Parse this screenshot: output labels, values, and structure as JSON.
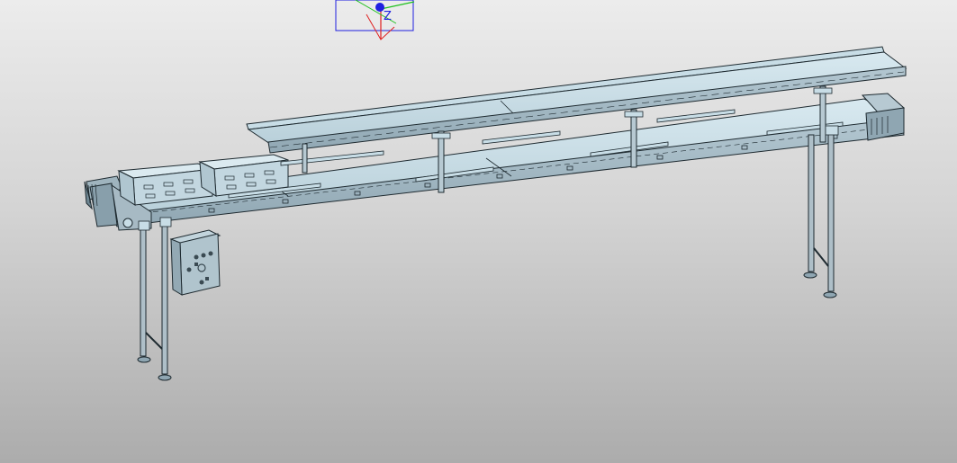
{
  "viewport": {
    "background_top": "#ececec",
    "background_bottom": "#acacac"
  },
  "triad": {
    "axis_label_z": "Z",
    "color_x": "#e02020",
    "color_y": "#20c020",
    "color_z": "#2020e0"
  },
  "model": {
    "surface_color": "#c8dde6",
    "edge_color": "#1e2a30",
    "frame_color": "#aebfc8",
    "panel_color": "#b7c9d2"
  },
  "control_box": {
    "icon": "control-panel-icon"
  }
}
